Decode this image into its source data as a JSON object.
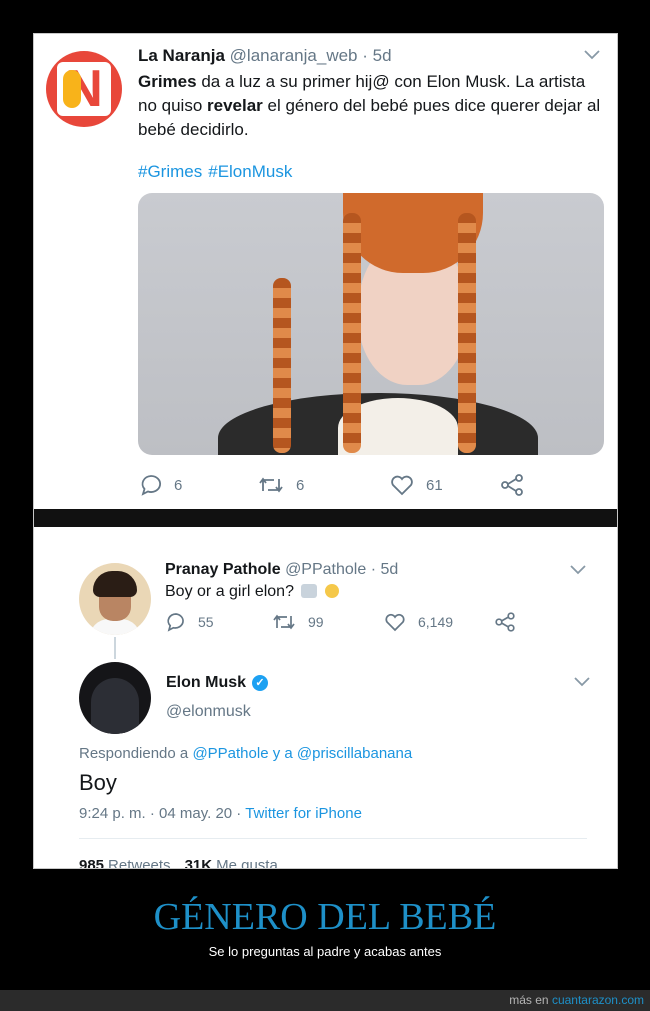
{
  "tweet1": {
    "name": "La Naranja",
    "handle": "@lanaranja_web",
    "time": "· 5d",
    "text_pre": "Grimes",
    "text_mid1": " da a luz a su primer hij@ con Elon Musk. La artista no quiso ",
    "text_bold2": "revelar",
    "text_end": " el género del bebé pues dice querer dejar al bebé decidirlo.",
    "hashtags": [
      "#Grimes",
      "#ElonMusk"
    ],
    "replies": "6",
    "retweets": "6",
    "likes": "61"
  },
  "tweet2": {
    "name": "Pranay Pathole",
    "handle": "@PPathole",
    "time": "· 5d",
    "text": "Boy or a girl elon?",
    "replies": "55",
    "retweets": "99",
    "likes": "6,149"
  },
  "tweet3": {
    "name": "Elon Musk",
    "handle": "@elonmusk",
    "reply_prefix": "Respondiendo a ",
    "reply_to1": "@PPathole",
    "reply_and": " y a ",
    "reply_to2": "@priscillabanana",
    "text": "Boy",
    "time": "9:24 p. m. · 04 may. 20 · ",
    "source": "Twitter for iPhone",
    "retweets_count": "985",
    "retweets_label": "Retweets",
    "likes_count": "31K",
    "likes_label": "Me gusta"
  },
  "caption": {
    "title": "GÉNERO DEL BEBÉ",
    "subtitle": "Se lo preguntas al padre y acabas antes"
  },
  "footer": {
    "prefix": "más en ",
    "site": "cuantarazon.com"
  },
  "colors": {
    "link": "#1b95e0",
    "caption": "#1e90c8"
  }
}
